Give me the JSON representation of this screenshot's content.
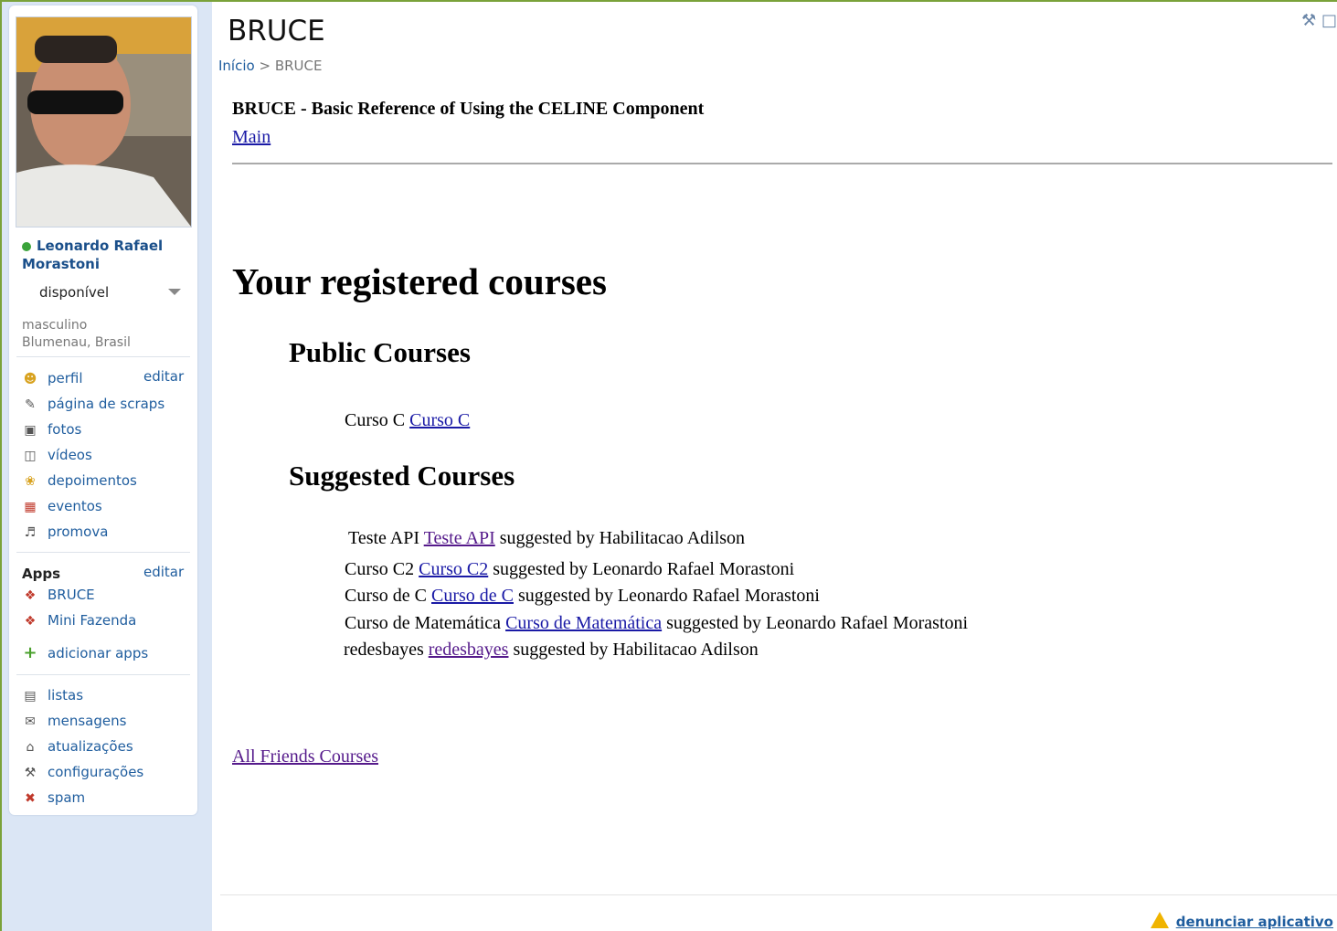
{
  "profile": {
    "name": "Leonardo Rafael Morastoni",
    "status": "disponível",
    "gender": "masculino",
    "location": "Blumenau, Brasil"
  },
  "nav": {
    "items": [
      {
        "label": "perfil",
        "icon": "profile-icon"
      },
      {
        "label": "página de scraps",
        "icon": "scrapbook-icon"
      },
      {
        "label": "fotos",
        "icon": "photos-icon"
      },
      {
        "label": "vídeos",
        "icon": "videos-icon"
      },
      {
        "label": "depoimentos",
        "icon": "testimonials-icon"
      },
      {
        "label": "eventos",
        "icon": "calendar-icon"
      },
      {
        "label": "promova",
        "icon": "promote-icon"
      }
    ],
    "edit_label": "editar"
  },
  "apps": {
    "heading": "Apps",
    "edit_label": "editar",
    "items": [
      {
        "label": "BRUCE",
        "icon": "app-icon"
      },
      {
        "label": "Mini Fazenda",
        "icon": "app-icon"
      }
    ],
    "add_label": "adicionar apps"
  },
  "tools": {
    "items": [
      {
        "label": "listas",
        "icon": "list-icon"
      },
      {
        "label": "mensagens",
        "icon": "mail-icon"
      },
      {
        "label": "atualizações",
        "icon": "updates-icon"
      },
      {
        "label": "configurações",
        "icon": "wrench-icon"
      },
      {
        "label": "spam",
        "icon": "spam-icon"
      }
    ]
  },
  "header": {
    "title": "BRUCE",
    "breadcrumb_home": "Início",
    "breadcrumb_sep": ">",
    "breadcrumb_current": "BRUCE"
  },
  "app": {
    "title": "BRUCE - Basic Reference of Using the CELINE Component",
    "main_link": "Main",
    "heading": "Your registered courses",
    "public_heading": "Public Courses",
    "public_courses": [
      {
        "name": "Curso C",
        "link": "Curso C"
      }
    ],
    "suggested_heading": "Suggested Courses",
    "suggested_by_label": "suggested by",
    "suggested_courses": [
      {
        "name": "Teste API",
        "link": "Teste API",
        "by": "Habilitacao Adilson"
      },
      {
        "name": "Curso C2",
        "link": "Curso C2",
        "by": "Leonardo Rafael Morastoni"
      },
      {
        "name": "Curso de C",
        "link": "Curso de C",
        "by": "Leonardo Rafael Morastoni"
      },
      {
        "name": "Curso de Matemática",
        "link": "Curso de Matemática",
        "by": "Leonardo Rafael Morastoni"
      },
      {
        "name": "redesbayes",
        "link": "redesbayes",
        "by": "Habilitacao Adilson"
      }
    ],
    "friends_link": "All Friends Courses"
  },
  "footer": {
    "report_label": "denunciar aplicativo"
  },
  "colors": {
    "link_blue": "#1f5d9e",
    "sidebar_bg": "#dbe6f5",
    "online_green": "#3aa33a"
  }
}
